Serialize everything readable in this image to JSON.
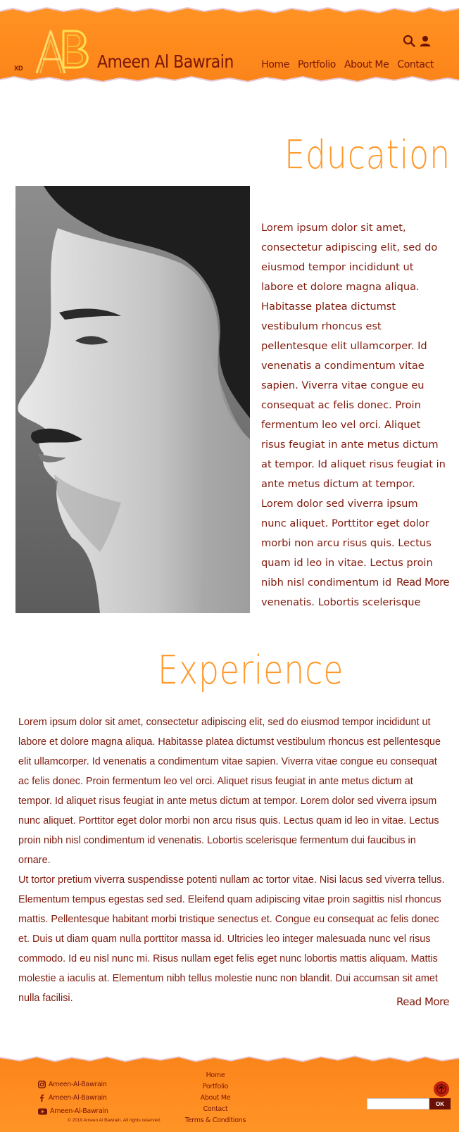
{
  "header": {
    "badge": "XD",
    "logo_text": "AB",
    "title": "Ameen Al Bawrain",
    "nav": [
      "Home",
      "Portfolio",
      "About Me",
      "Contact"
    ],
    "icons": [
      "search-icon",
      "user-icon"
    ]
  },
  "education": {
    "title": "Education",
    "photo_alt": "profile-photo",
    "text": "Lorem ipsum dolor sit amet, consectetur adipiscing elit, sed do eiusmod tempor incididunt ut labore et dolore magna aliqua. Habitasse platea dictumst vestibulum rhoncus est pellentesque elit ullamcorper. Id venenatis a condimentum vitae sapien. Viverra vitae congue eu consequat ac felis donec. Proin fermentum leo vel orci. Aliquet risus feugiat in ante metus dictum at tempor. Id aliquet risus feugiat in ante metus dictum at tempor. Lorem dolor sed viverra ipsum nunc aliquet. Porttitor eget dolor morbi non arcu risus quis. Lectus quam id leo in vitae. Lectus proin nibh nisl condimentum id venenatis. Lobortis scelerisque",
    "read_more": "Read More"
  },
  "experience": {
    "title": "Experience",
    "paragraph1": "Lorem ipsum dolor sit amet, consectetur adipiscing elit, sed do eiusmod tempor incididunt ut labore et dolore magna aliqua. Habitasse platea dictumst vestibulum rhoncus est pellentesque elit ullamcorper. Id venenatis a condimentum vitae sapien. Viverra vitae congue eu consequat ac felis donec. Proin fermentum leo vel orci. Aliquet risus feugiat in ante metus dictum at tempor. Id aliquet risus feugiat in ante metus dictum at tempor. Lorem dolor sed viverra ipsum nunc aliquet. Porttitor eget dolor morbi non arcu risus quis. Lectus quam id leo in vitae. Lectus proin nibh nisl condimentum id venenatis. Lobortis scelerisque fermentum dui faucibus in ornare.",
    "paragraph2": "Ut tortor pretium viverra suspendisse potenti nullam ac tortor vitae. Nisi lacus sed viverra tellus. Elementum tempus egestas sed sed. Eleifend quam adipiscing vitae proin sagittis nisl rhoncus mattis. Pellentesque habitant morbi tristique senectus et. Congue eu consequat ac felis donec et. Duis ut diam quam nulla porttitor massa id. Ultricies leo integer malesuada nunc vel risus commodo. Id eu nisl nunc mi. Risus nullam eget felis eget nunc lobortis mattis aliquam. Mattis molestie a iaculis at. Elementum nibh tellus molestie nunc non blandit. Dui accumsan sit amet nulla facilisi.",
    "read_more": "Read More"
  },
  "footer": {
    "social": [
      {
        "icon": "instagram-icon",
        "label": "Ameen-Al-Bawrain"
      },
      {
        "icon": "facebook-icon",
        "label": "Ameen-Al-Bawrain"
      },
      {
        "icon": "youtube-icon",
        "label": "Ameen-Al-Bawrain"
      }
    ],
    "copyright": "© 2019 Ameen Al Bawrain. All rights reserved.",
    "links": [
      "Home",
      "Portfolio",
      "About Me",
      "Contact",
      "Terms & Conditions"
    ],
    "ok_label": "OK",
    "up_icon": "arrow-up-icon"
  },
  "colors": {
    "accent": "#ff8c20",
    "title_orange": "#ff9a2e",
    "text_maroon": "#7e1a0c",
    "button_dark": "#6b1007"
  }
}
